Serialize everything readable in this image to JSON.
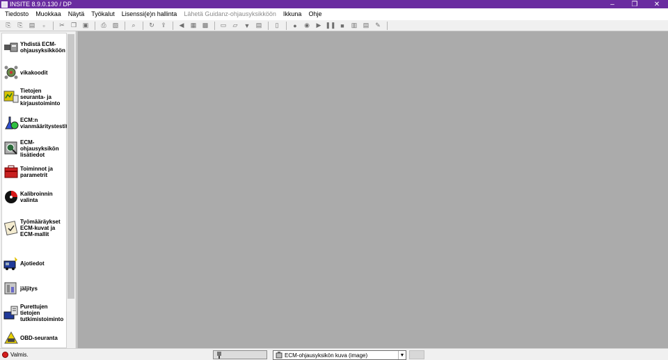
{
  "window": {
    "title": "INSITE 8.9.0.130  / DP",
    "controls": [
      "–",
      "❐",
      "✕"
    ]
  },
  "menu": [
    {
      "label": "Tiedosto",
      "enabled": true
    },
    {
      "label": "Muokkaa",
      "enabled": true
    },
    {
      "label": "Näytä",
      "enabled": true
    },
    {
      "label": "Työkalut",
      "enabled": true
    },
    {
      "label": "Lisenssi(e)n hallinta",
      "enabled": true
    },
    {
      "label": "Lähetä Guidanz-ohjausyksikköön",
      "enabled": false
    },
    {
      "label": "Ikkuna",
      "enabled": true
    },
    {
      "label": "Ohje",
      "enabled": true
    }
  ],
  "sidebar": {
    "items": [
      {
        "label": "Yhdistä ECM-ohjausyksikköön",
        "icon": "ecm-connect-icon"
      },
      {
        "label": "vikakoodit",
        "icon": "fault-codes-icon"
      },
      {
        "label": "Tietojen seuranta- ja kirjaustoiminto",
        "icon": "data-monitor-icon"
      },
      {
        "label": "ECM:n vianmääritystestit",
        "icon": "diagnostic-flask-icon"
      },
      {
        "label": "ECM-ohjausyksikön lisätiedot",
        "icon": "ecm-info-icon"
      },
      {
        "label": "Toiminnot ja parametrit",
        "icon": "toolbox-icon"
      },
      {
        "label": "Kalibroinnin valinta",
        "icon": "calibration-disc-icon"
      },
      {
        "label": "Työmääräykset ECM-kuvat ja ECM-mallit",
        "icon": "work-order-icon"
      },
      {
        "label": "Ajotiedot",
        "icon": "trip-data-icon"
      },
      {
        "label": "jäljitys",
        "icon": "trace-icon"
      },
      {
        "label": "Purettujen tietojen tutkimistoiminto",
        "icon": "extracted-data-icon"
      },
      {
        "label": "OBD-seuranta",
        "icon": "obd-monitor-icon"
      }
    ]
  },
  "status": {
    "text": "Valmis.",
    "dropdown_value": "ECM-ohjausyksikön kuva (image)"
  },
  "colors": {
    "titlebar": "#6a2ca0",
    "workspace": "#ababab",
    "status_dot": "#d42020"
  }
}
